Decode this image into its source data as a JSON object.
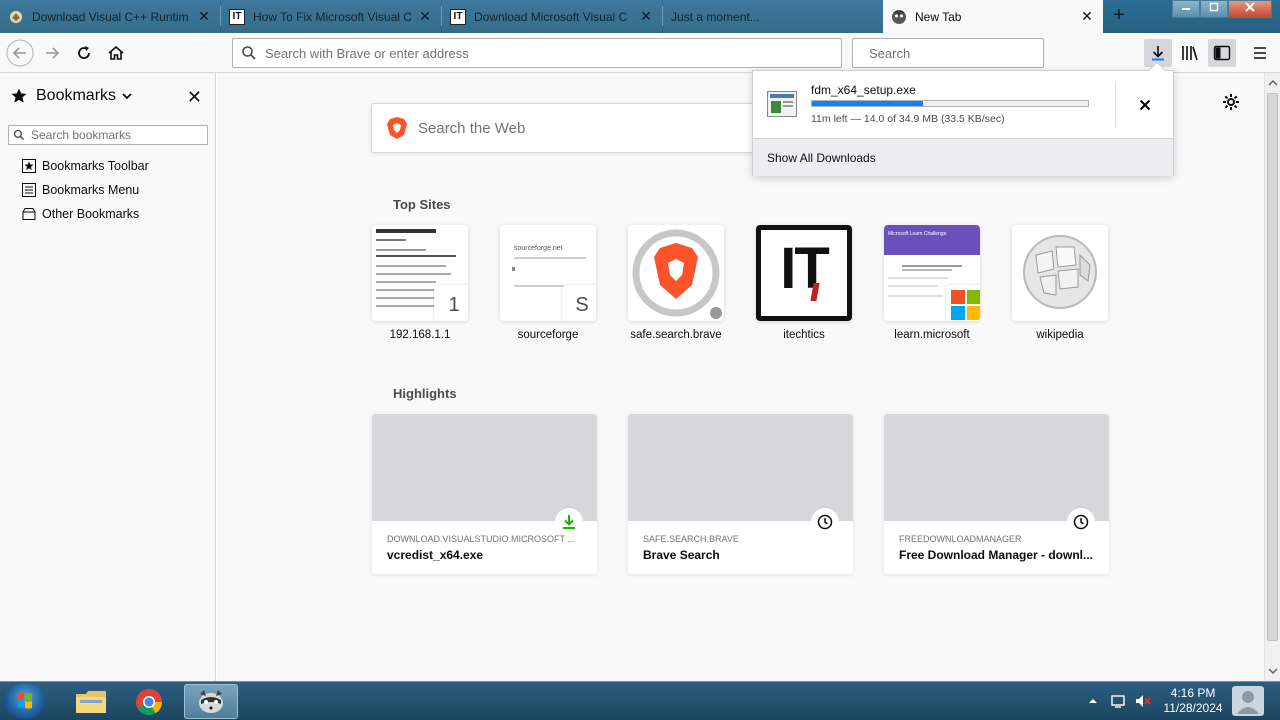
{
  "tabs": [
    {
      "title": "Download Visual C++ Runtim",
      "icon": "visual-studio-icon",
      "active": false
    },
    {
      "title": "How To Fix Microsoft Visual C",
      "icon": "itechtics-icon",
      "active": false
    },
    {
      "title": "Download Microsoft Visual C",
      "icon": "itechtics-icon",
      "active": false
    },
    {
      "title": "Just a moment...",
      "icon": "none",
      "active": false
    },
    {
      "title": "New Tab",
      "icon": "fdm-icon",
      "active": true
    }
  ],
  "navbar": {
    "url_placeholder": "Search with Brave or enter address",
    "search_placeholder": "Search"
  },
  "sidebar": {
    "title": "Bookmarks",
    "search_placeholder": "Search bookmarks",
    "items": [
      {
        "label": "Bookmarks Toolbar",
        "icon": "bookmarks-toolbar-icon"
      },
      {
        "label": "Bookmarks Menu",
        "icon": "bookmarks-menu-icon"
      },
      {
        "label": "Other Bookmarks",
        "icon": "other-bookmarks-icon"
      }
    ]
  },
  "main": {
    "websearch_placeholder": "Search the Web",
    "top_sites_title": "Top Sites",
    "top_sites": [
      {
        "label": "192.168.1.1",
        "badge": "1"
      },
      {
        "label": "sourceforge",
        "badge": "S",
        "thumb_text": "sourceforge.net"
      },
      {
        "label": "safe.search.brave"
      },
      {
        "label": "itechtics",
        "logo_text": "IT"
      },
      {
        "label": "learn.microsoft",
        "thumb_text": "Microsoft Learn Challenge"
      },
      {
        "label": "wikipedia"
      }
    ],
    "highlights_title": "Highlights",
    "highlights": [
      {
        "source": "DOWNLOAD.VISUALSTUDIO.MICROSOFT ...",
        "title": "vcredist_x64.exe",
        "badge": "download-icon"
      },
      {
        "source": "SAFE.SEARCH.BRAVE",
        "title": "Brave Search",
        "badge": "clock-icon"
      },
      {
        "source": "FREEDOWNLOADMANAGER",
        "title": "Free Download Manager - downl...",
        "badge": "clock-icon"
      }
    ]
  },
  "downloads": {
    "file_name": "fdm_x64_setup.exe",
    "status": "11m left — 14.0 of 34.9 MB (33.5 KB/sec)",
    "progress_fraction": 0.401,
    "show_all": "Show All Downloads"
  },
  "taskbar": {
    "time": "4:16 PM",
    "date": "11/28/2024"
  },
  "colors": {
    "accent": "#0a84ff",
    "brave_orange": "#fb542b",
    "titlebar": "#2e6d96"
  }
}
